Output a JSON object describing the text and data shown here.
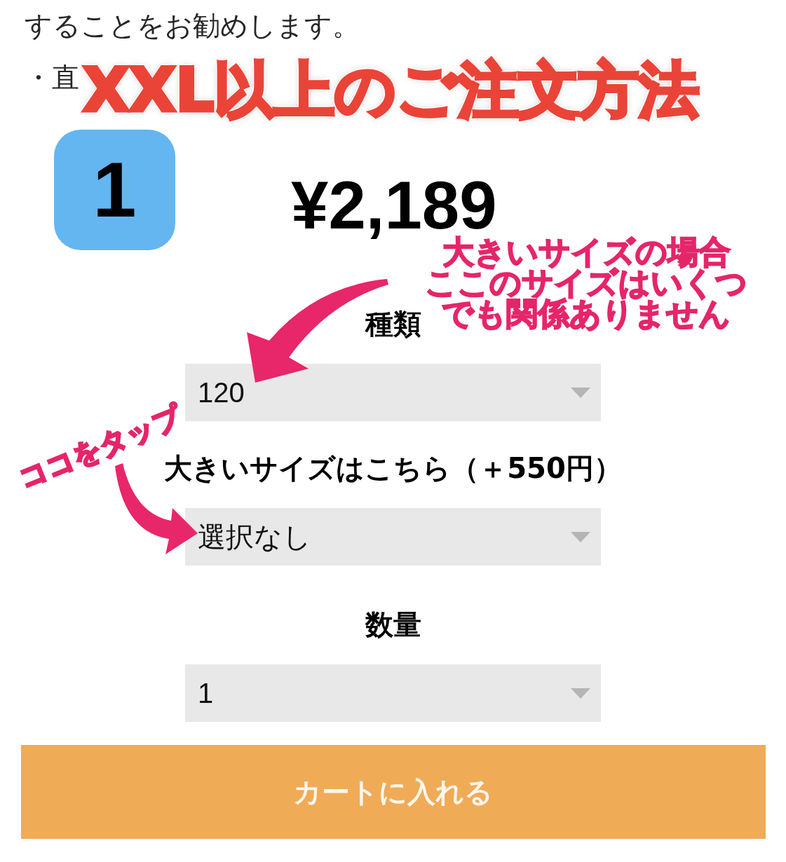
{
  "intro_lines": [
    "することをお勧めします。",
    "・直"
  ],
  "banner_title": "XXL以上のご注文方法",
  "step": {
    "number": "1",
    "price": "¥2,189"
  },
  "size_note": {
    "lines": [
      "大きいサイズの場合",
      "ここのサイズはいくつ",
      "でも関係ありません"
    ]
  },
  "tap_note": "ココをタップ",
  "options": [
    {
      "heading": "種類",
      "dropdown": {
        "value": "120"
      }
    },
    {
      "heading": "大きいサイズはこちら（＋550円）",
      "dropdown": {
        "value": "選択なし"
      }
    },
    {
      "heading": "数量",
      "dropdown": {
        "value": "1"
      }
    }
  ],
  "cart_button": "カートに入れる"
}
